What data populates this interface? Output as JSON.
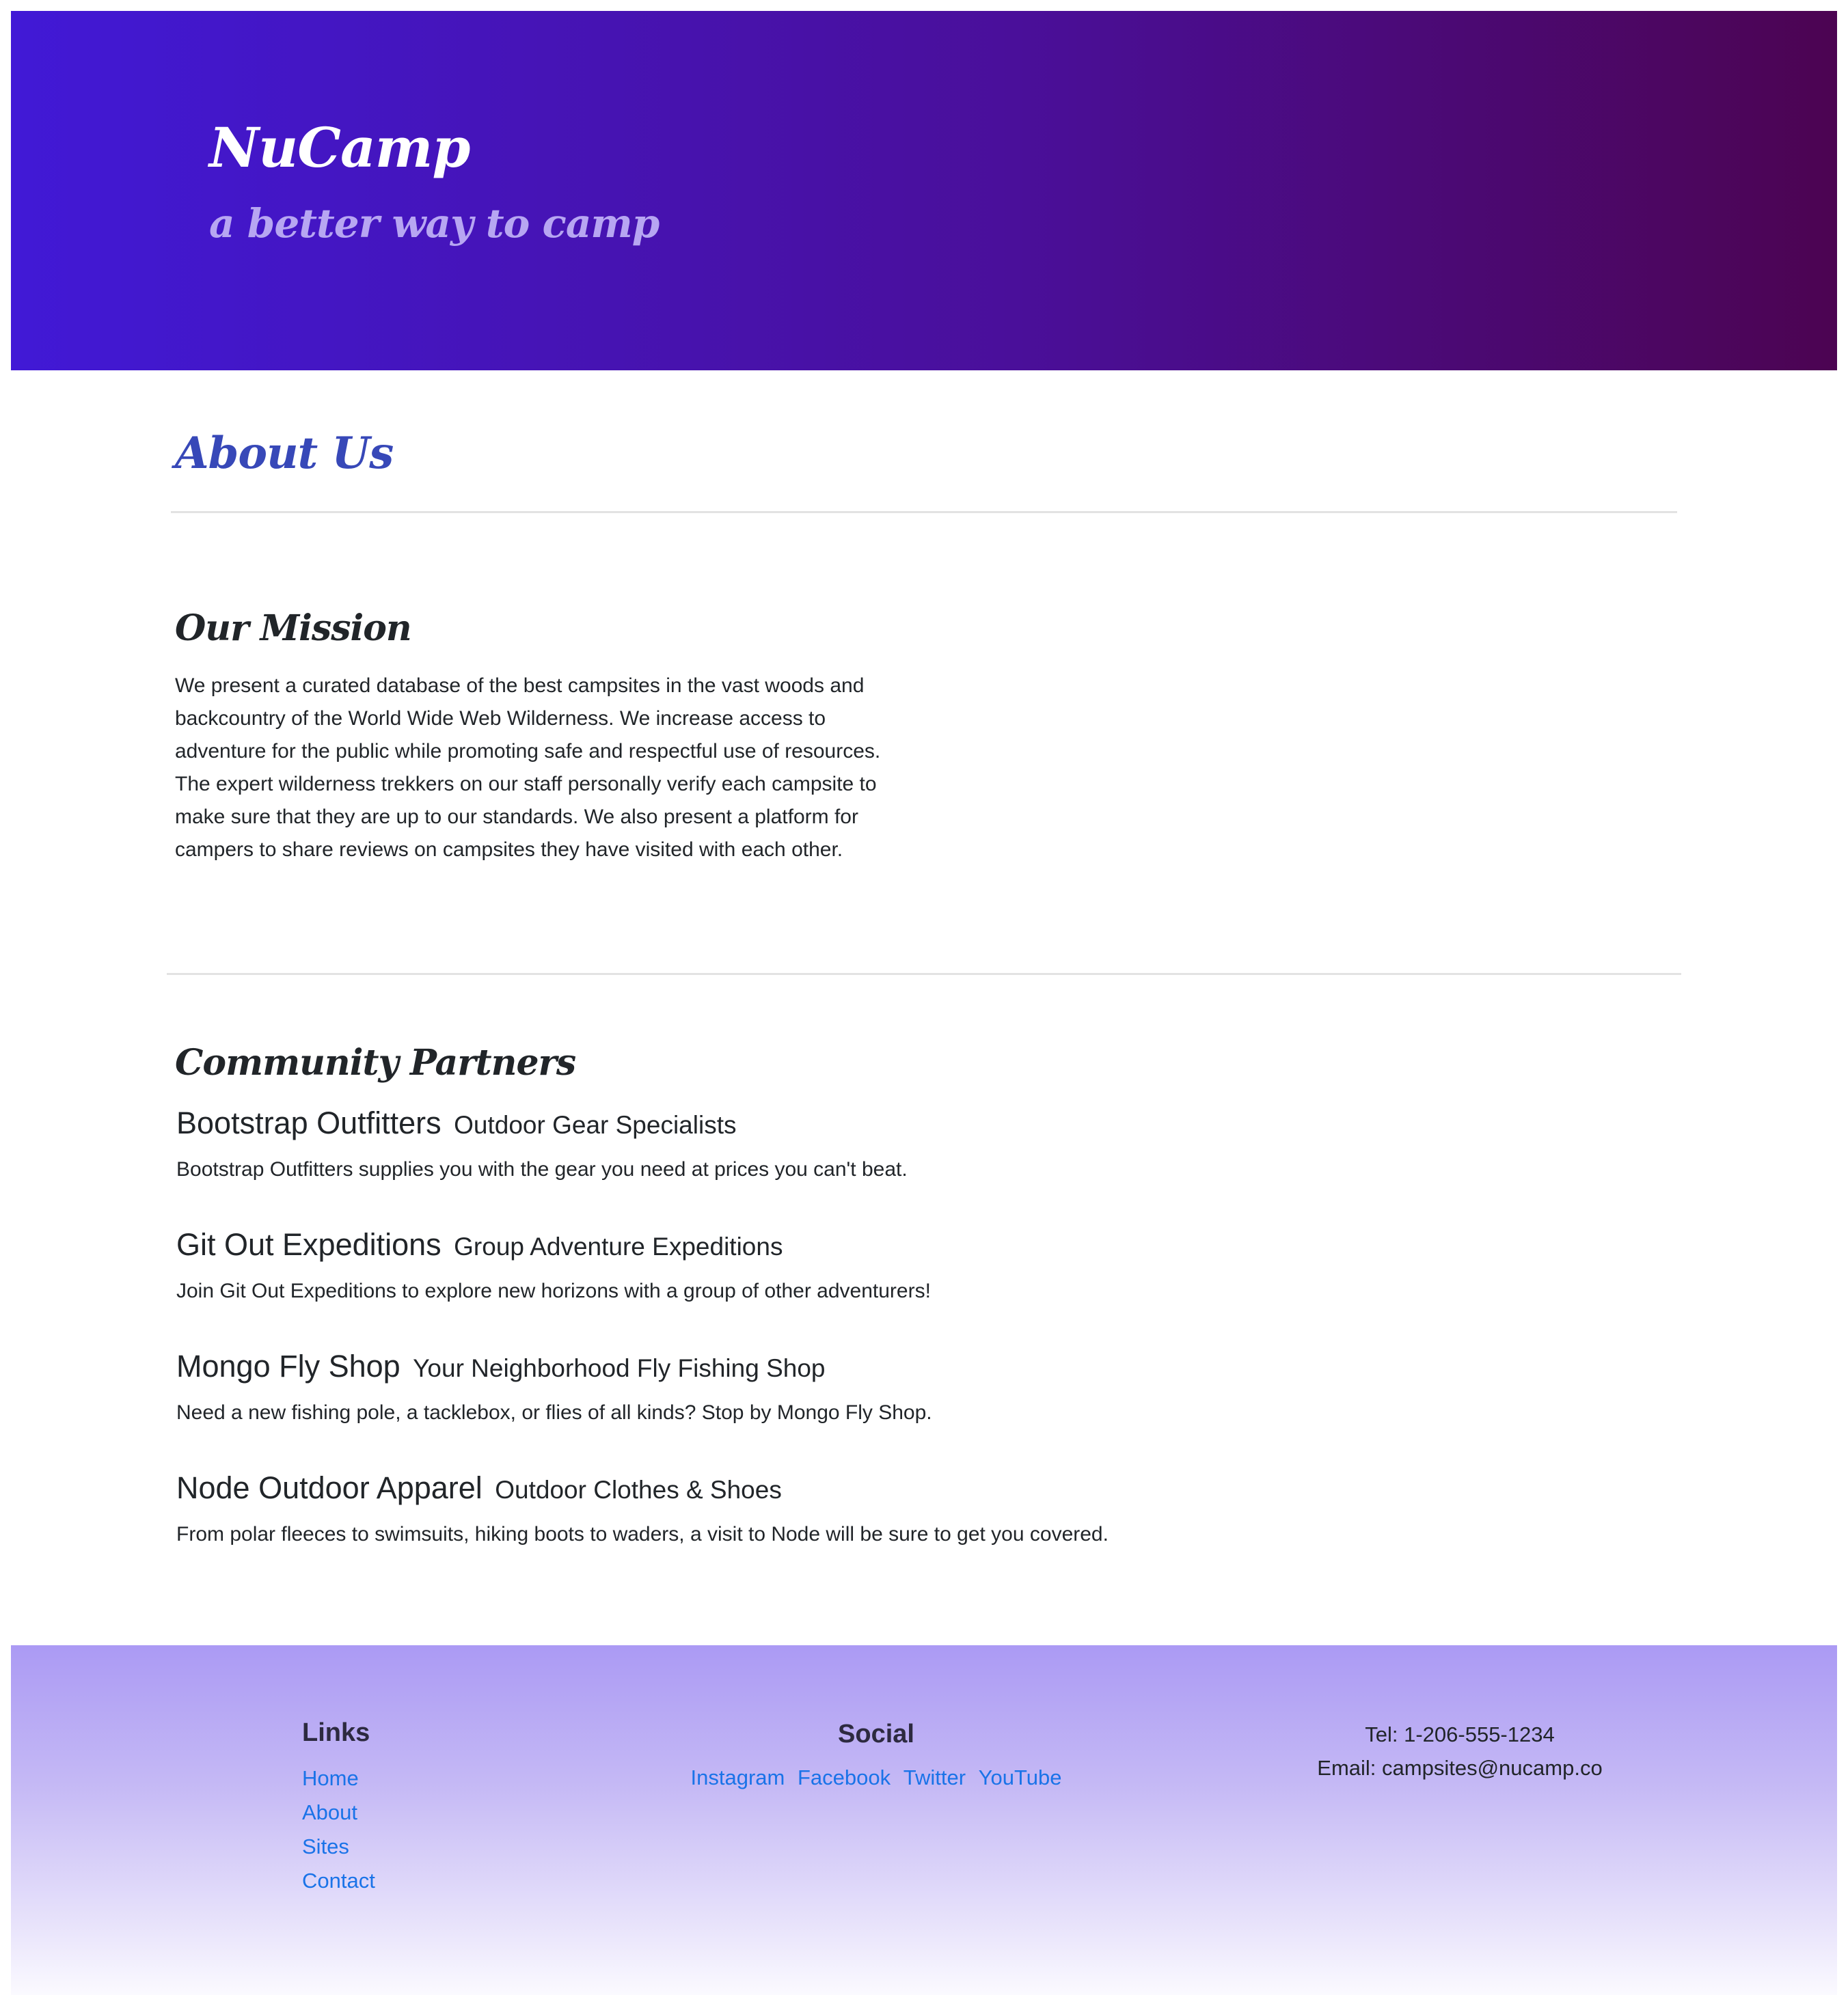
{
  "header": {
    "brand": "NuCamp",
    "tagline": "a better way to camp"
  },
  "about": {
    "title": "About Us"
  },
  "mission": {
    "title": "Our Mission",
    "text": "We present a curated database of the best campsites in the vast woods and backcountry of the World Wide Web Wilderness. We increase access to adventure for the public while promoting safe and respectful use of resources. The expert wilderness trekkers on our staff personally verify each campsite to make sure that they are up to our standards. We also present a platform for campers to share reviews on campsites they have visited with each other."
  },
  "partners": {
    "title": "Community Partners",
    "items": [
      {
        "name": "Bootstrap Outfitters",
        "role": "Outdoor Gear Specialists",
        "description": "Bootstrap Outfitters supplies you with the gear you need at prices you can't beat."
      },
      {
        "name": "Git Out Expeditions",
        "role": "Group Adventure Expeditions",
        "description": "Join Git Out Expeditions to explore new horizons with a group of other adventurers!"
      },
      {
        "name": "Mongo Fly Shop",
        "role": "Your Neighborhood Fly Fishing Shop",
        "description": "Need a new fishing pole, a tacklebox, or flies of all kinds? Stop by Mongo Fly Shop."
      },
      {
        "name": "Node Outdoor Apparel",
        "role": "Outdoor Clothes & Shoes",
        "description": "From polar fleeces to swimsuits, hiking boots to waders, a visit to Node will be sure to get you covered."
      }
    ]
  },
  "footer": {
    "links_heading": "Links",
    "links": [
      "Home",
      "About",
      "Sites",
      "Contact"
    ],
    "social_heading": "Social",
    "social": [
      "Instagram",
      "Facebook",
      "Twitter",
      "YouTube"
    ],
    "tel": "Tel: 1-206-555-1234",
    "email": "Email: campsites@nucamp.co"
  },
  "colors": {
    "header_gradient_start": "#4119d6",
    "header_gradient_end": "#4c0452",
    "tagline": "#b7a6f2",
    "about_title": "#3748b8",
    "link": "#1a73e8",
    "footer_gradient_top": "#ab9af4",
    "footer_gradient_bottom": "#fbfaff"
  }
}
